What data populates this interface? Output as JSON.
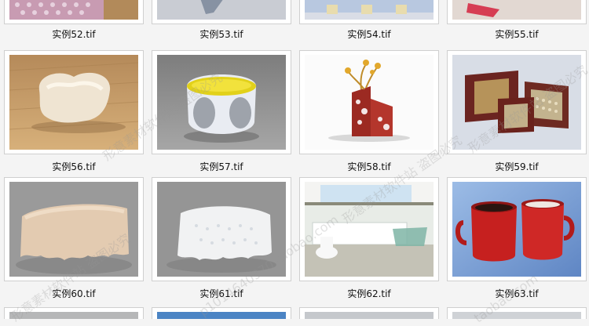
{
  "files": {
    "row_top": [
      "实例52.tif",
      "实例53.tif",
      "实例54.tif",
      "实例55.tif"
    ],
    "row1": [
      "实例56.tif",
      "实例57.tif",
      "实例58.tif",
      "实例59.tif"
    ],
    "row2": [
      "实例60.tif",
      "实例61.tif",
      "实例62.tif",
      "实例63.tif"
    ]
  },
  "watermarks": [
    "形意素材软件站 盗图必究",
    "形意素材软件站 盗图必究",
    "p1014640370.taobao.com",
    "形意素材软件站 盗图必究",
    "形意素材软件站 盗图必究",
    "taobao.com"
  ]
}
